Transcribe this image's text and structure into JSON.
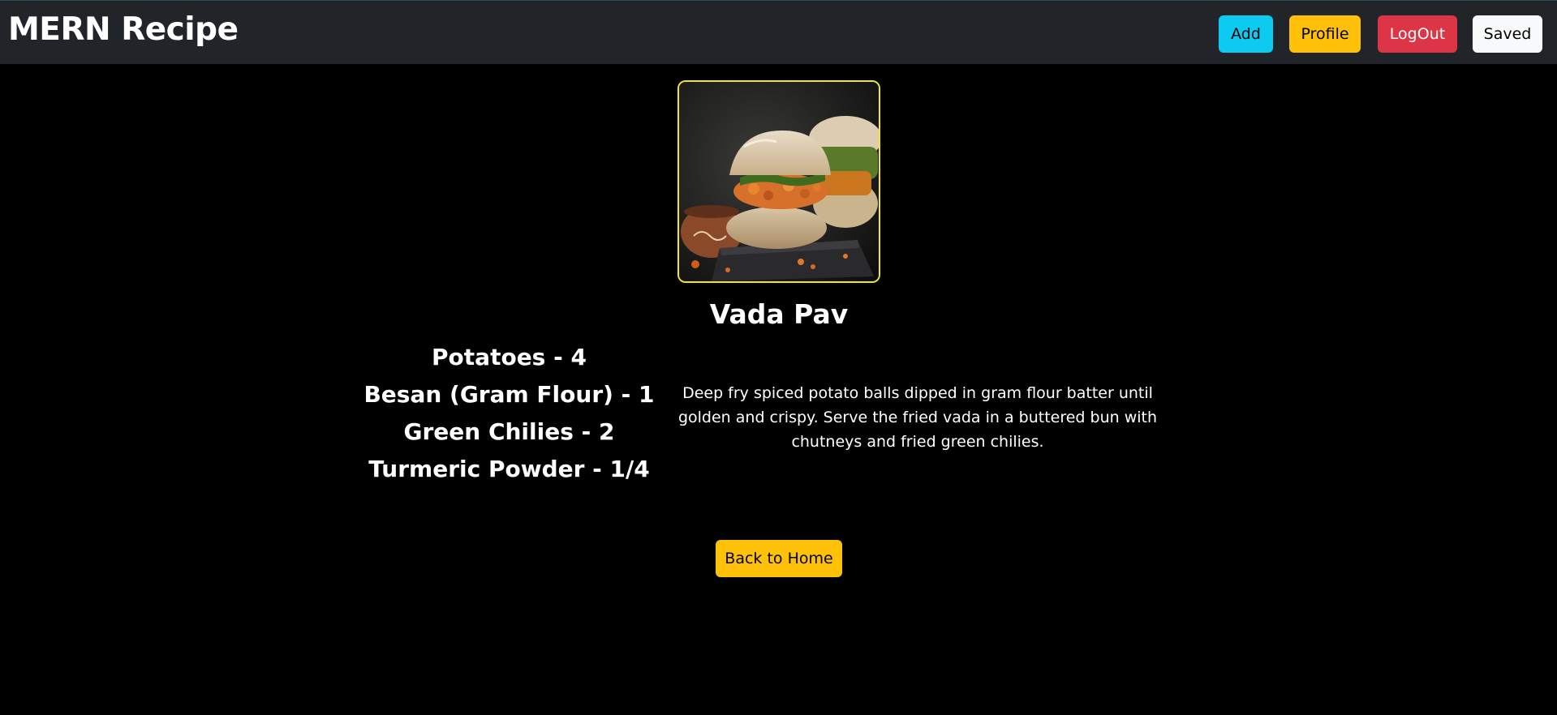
{
  "navbar": {
    "brand": "MERN Recipe",
    "buttons": {
      "add": "Add",
      "profile": "Profile",
      "logout": "LogOut",
      "saved": "Saved"
    }
  },
  "recipe": {
    "image_alt": "Vada Pav",
    "title": "Vada Pav",
    "ingredients": [
      "Potatoes - 4",
      "Besan (Gram Flour) - 1",
      "Green Chilies - 2",
      "Turmeric Powder - 1/4"
    ],
    "instructions": "Deep fry spiced potato balls dipped in gram flour batter until golden and crispy. Serve the fried vada in a buttered bun with chutneys and fried green chilies."
  },
  "back_button": "Back to Home",
  "colors": {
    "navbar_bg": "#212529",
    "page_bg": "#000000",
    "add": "#0dcaf0",
    "profile": "#ffc107",
    "logout": "#dc3545",
    "saved": "#f8f9fa",
    "image_border": "#f5e61c"
  }
}
